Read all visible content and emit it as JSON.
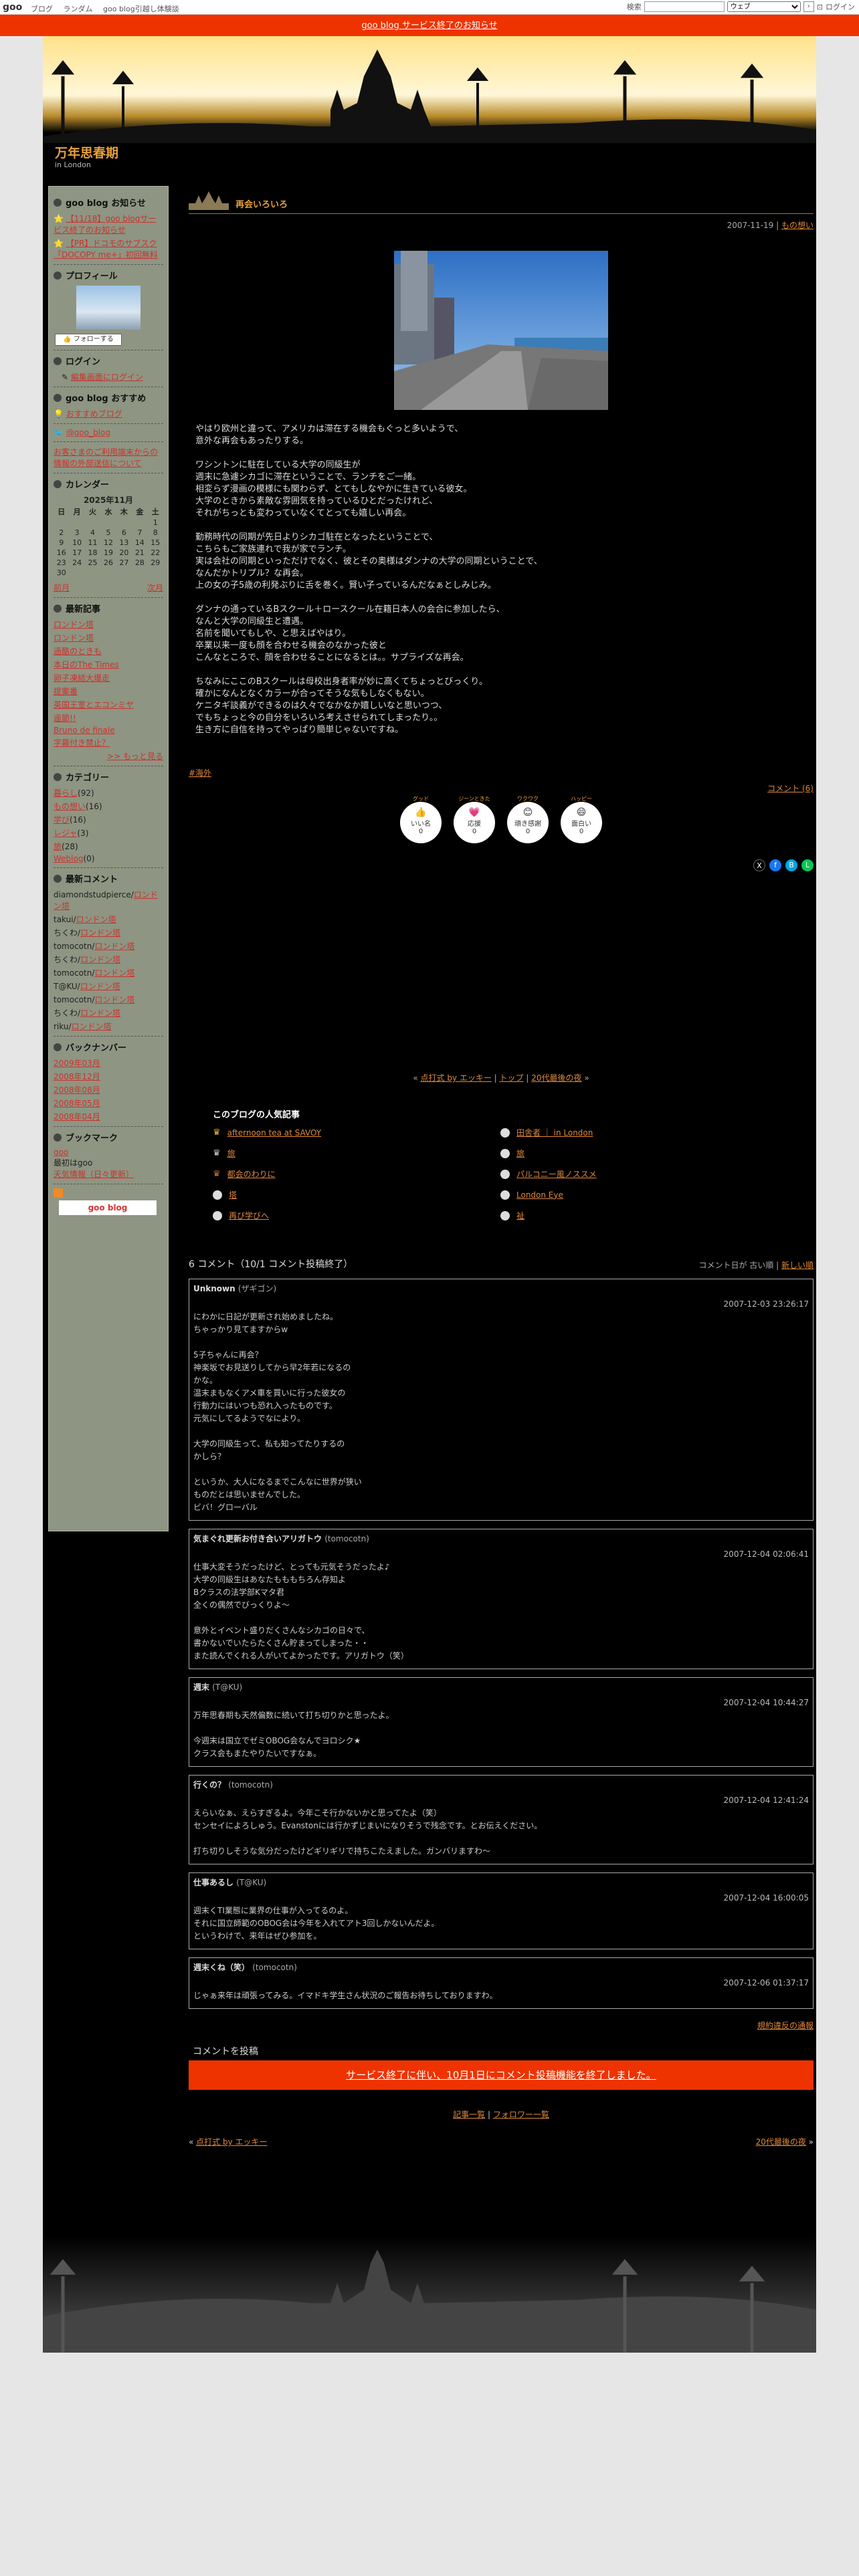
{
  "topbar": {
    "logo": "goo",
    "nav": [
      "ブログ",
      "ランダム",
      "goo blog引越し体験談"
    ],
    "search_label": "検索",
    "search_scope": "ウェブ",
    "login": "ログイン"
  },
  "notice": "goo blog サービス終了のお知らせ",
  "blog": {
    "title": "万年思春期",
    "subtitle": "in London"
  },
  "sidebar": {
    "news_heading": "goo blog お知らせ",
    "news": [
      "【11/18】goo blogサービス終了のお知らせ",
      "【PR】ドコモのサブスク「DOCOPY me+」初回無料"
    ],
    "profile_heading": "プロフィール",
    "follow_button": "フォローする",
    "login_heading": "ログイン",
    "login_link": "編集画面にログイン",
    "recommend_heading": "goo blog おすすめ",
    "recommend_link": "おすすめブログ",
    "twitter_link": "@goo_blog",
    "privacy_link": "お客さまのご利用端末からの情報の外部送信について",
    "calendar_heading": "カレンダー",
    "calendar_month": "2025年11月",
    "calendar_days": [
      "日",
      "月",
      "火",
      "水",
      "木",
      "金",
      "土"
    ],
    "calendar_rows": [
      [
        "",
        "",
        "",
        "",
        "",
        "",
        "1"
      ],
      [
        "2",
        "3",
        "4",
        "5",
        "6",
        "7",
        "8"
      ],
      [
        "9",
        "10",
        "11",
        "12",
        "13",
        "14",
        "15"
      ],
      [
        "16",
        "17",
        "18",
        "19",
        "20",
        "21",
        "22"
      ],
      [
        "23",
        "24",
        "25",
        "26",
        "27",
        "28",
        "29"
      ],
      [
        "30",
        "",
        "",
        "",
        "",
        "",
        ""
      ]
    ],
    "prev_month": "前月",
    "next_month": "次月",
    "recent_heading": "最新記事",
    "recent": [
      "ロンドン塔",
      "ロンドン塔",
      "過酷のときも",
      "本日のThe Times",
      "卵子凍結大爆走",
      "提案番",
      "英国王室とエコンミヤ",
      "遥節!!",
      "Bruno de finale",
      "字幕付き禁止？"
    ],
    "recent_more": ">> もっと見る",
    "category_heading": "カテゴリー",
    "categories": [
      {
        "name": "暮らし",
        "count": "(92)"
      },
      {
        "name": "もの想い",
        "count": "(16)"
      },
      {
        "name": "学び",
        "count": "(16)"
      },
      {
        "name": "レジャ",
        "count": "(3)"
      },
      {
        "name": "旅",
        "count": "(28)"
      },
      {
        "name": "Weblog",
        "count": "(0)"
      }
    ],
    "comments_heading": "最新コメント",
    "comments": [
      {
        "who": "diamondstudpierce",
        "on": "ロンドン塔"
      },
      {
        "who": "takui",
        "on": "ロンドン塔"
      },
      {
        "who": "ちくわ",
        "on": "ロンドン塔"
      },
      {
        "who": "tomocotn",
        "on": "ロンドン塔"
      },
      {
        "who": "ちくわ",
        "on": "ロンドン塔"
      },
      {
        "who": "tomocotn",
        "on": "ロンドン塔"
      },
      {
        "who": "T@KU",
        "on": "ロンドン塔"
      },
      {
        "who": "tomocotn",
        "on": "ロンドン塔"
      },
      {
        "who": "ちくわ",
        "on": "ロンドン塔"
      },
      {
        "who": "riku",
        "on": "ロンドン塔"
      }
    ],
    "backnumber_heading": "バックナンバー",
    "backnumbers": [
      "2009年03月",
      "2008年12月",
      "2008年08月",
      "2008年05月",
      "2008年04月"
    ],
    "bookmark_heading": "ブックマーク",
    "bookmark_1": "goo",
    "bookmark_1_desc": "最初はgoo",
    "bookmark_2": "天気情報（日々更新）",
    "goo_blog_badge": "goo blog"
  },
  "post": {
    "title": "再会いろいろ",
    "date": "2007-11-19",
    "category": "もの想い",
    "paragraphs": [
      [
        "やはり欧州と違って、アメリカは滞在する機会もぐっと多いようで、",
        "意外な再会もあったりする。"
      ],
      [
        "ワシントンに駐在している大学の同級生が",
        "週末に急遽シカゴに滞在ということで、ランチをご一緒。",
        "相変らず漫画の模様にも関わらず、とてもしなやかに生きている彼女。",
        "大学のときから素敵な雰囲気を持っているひとだったけれど、",
        "それがちっとも変わっていなくてとっても嬉しい再会。"
      ],
      [
        "勤務時代の同期が先日よりシカゴ駐在となったということで、",
        "こちらもご家族連れで我が家でランチ。",
        "実は会社の同期といっただけでなく、彼とその奥様はダンナの大学の同期ということで、",
        "なんだかトリプル？な再会。",
        "上の女の子5歳の利発ぶりに舌を巻く。賢い子っているんだなぁとしみじみ。"
      ],
      [
        "ダンナの通っているBスクール＋ロースクール在籍日本人の会合に参加したら、",
        "なんと大学の同級生と遭遇。",
        "名前を聞いてもしや、と思えばやはり。",
        "卒業以来一度も顔を合わせる機会のなかった彼と",
        "こんなところで、顔を合わせることになるとは。。サプライズな再会。"
      ],
      [
        "ちなみにここのBスクールは母校出身者率が妙に高くてちょっとびっくり。",
        "確かになんとなくカラーが合ってそうな気もしなくもない。",
        "ケニタギ談義ができるのは久々でなかなか嬉しいなと思いつつ、",
        "でもちょっと今の自分をいろいろ考えさせられてしまったり。。",
        "生き方に自信を持ってやっぱり簡単じゃないですね。"
      ]
    ],
    "tag": "#海外",
    "comment_link": "コメント (6)",
    "reactions": [
      {
        "label": "グッド",
        "name": "いい名",
        "count": "0"
      },
      {
        "label": "ジーンときた",
        "name": "応援",
        "count": "0"
      },
      {
        "label": "ワクワク",
        "name": "頑き感謝",
        "count": "0"
      },
      {
        "label": "ハッピー",
        "name": "面白い",
        "count": "0"
      }
    ],
    "nav_prev": "点打式 by エッキー",
    "nav_top": "トップ",
    "nav_next": "20代最後の夜"
  },
  "popular": {
    "heading": "このブログの人気記事",
    "items": [
      "afternoon tea at SAVOY",
      "田舎者 ｜ in London",
      "旅",
      "旅",
      "都会のわりに",
      "パルコニー風ノススメ",
      "塔",
      "London Eye",
      "再び学びへ",
      "祉"
    ]
  },
  "comments": {
    "heading": "6 コメント（10/1 コメント投稿終了）",
    "sort_label": "コメント日が",
    "sort_old": "古い順",
    "sort_new": "新しい順",
    "items": [
      {
        "who": "Unknown",
        "tag": "(ザギゴン)",
        "when": "2007-12-03 23:26:17",
        "lines": [
          "にわかに日記が更新され始めましたね。",
          "ちゃっかり見てますからw",
          "",
          "5子ちゃんに再会？",
          "神楽坂でお見送りしてから早2年若になるの",
          "かな。",
          "温末まもなくアメ車を買いに行った彼女の",
          "行動力にはいつも恐れ入ったものです。",
          "元気にしてるようでなにより。",
          "",
          "大学の同級生って、私も知ってたりするの",
          "かしら？",
          "",
          "というか、大人になるまでこんなに世界が狭い",
          "ものだとは思いませんでした。",
          "ビバ！グローバル"
        ]
      },
      {
        "who": "気まぐれ更新お付き合いアリガトウ",
        "tag": "(tomocotn)",
        "when": "2007-12-04 02:06:41",
        "lines": [
          "仕事大変そうだったけど、とっても元気そうだったよ♪",
          "大学の同級生はあなたもももちろん存知よ",
          "Bクラスの法学部Kマタ君",
          "全くの偶然でびっくりよ〜",
          "",
          "意外とイベント盛りだくさんなシカゴの日々で、",
          "書かないでいたらたくさん貯まってしまった・・",
          "また読んでくれる人がいてよかったです。アリガトウ（笑）"
        ]
      },
      {
        "who": "週末",
        "tag": "(T@KU)",
        "when": "2007-12-04 10:44:27",
        "lines": [
          "万年思春期も天然偏数に続いて打ち切りかと思ったよ。",
          "",
          "今週末は国立でゼミOBOG会なんでヨロシク★",
          "クラス会もまたやりたいですなぁ。"
        ]
      },
      {
        "who": "行くの？",
        "tag": "(tomocotn)",
        "when": "2007-12-04 12:41:24",
        "lines": [
          "えらいなぁ、えらすぎるよ。今年こそ行かないかと思ってたよ（笑）",
          "センセイによろしゅう。Evanstonには行かずじまいになりそうで残念です。とお伝えください。",
          "",
          "打ち切りしそうな気分だったけどギリギリで持ちこたえました。ガンバリますわ〜"
        ]
      },
      {
        "who": "仕事あるし",
        "tag": "(T@KU)",
        "when": "2007-12-04 16:00:05",
        "lines": [
          "週末くTI業態に業界の仕事が入ってるのよ。",
          "それに国立師範のOBOG会は今年を入れてアト3回しかないんだよ。",
          "というわけで、来年はぜひ参加を。"
        ]
      },
      {
        "who": "週末くね（笑）",
        "tag": "(tomocotn)",
        "when": "2007-12-06 01:37:17",
        "lines": [
          "じゃぁ来年は頑張ってみる。イマドキ学生さん状況のご報告お待ちしておりますわ。"
        ]
      }
    ],
    "guideline": "規約違反の通報",
    "post_heading": "コメントを投稿",
    "end_notice": "サービス終了に伴い、10月1日にコメント投稿機能を終了しました。",
    "list_1": "記事一覧",
    "list_2": "フォロワー一覧",
    "bottom_prev": "点打式 by エッキー",
    "bottom_next": "20代最後の夜"
  },
  "colors": {
    "accent": "#e6a23a",
    "link": "#e0883a",
    "notice_bg": "#ee3300",
    "sidebar_bg": "#8e9582"
  }
}
